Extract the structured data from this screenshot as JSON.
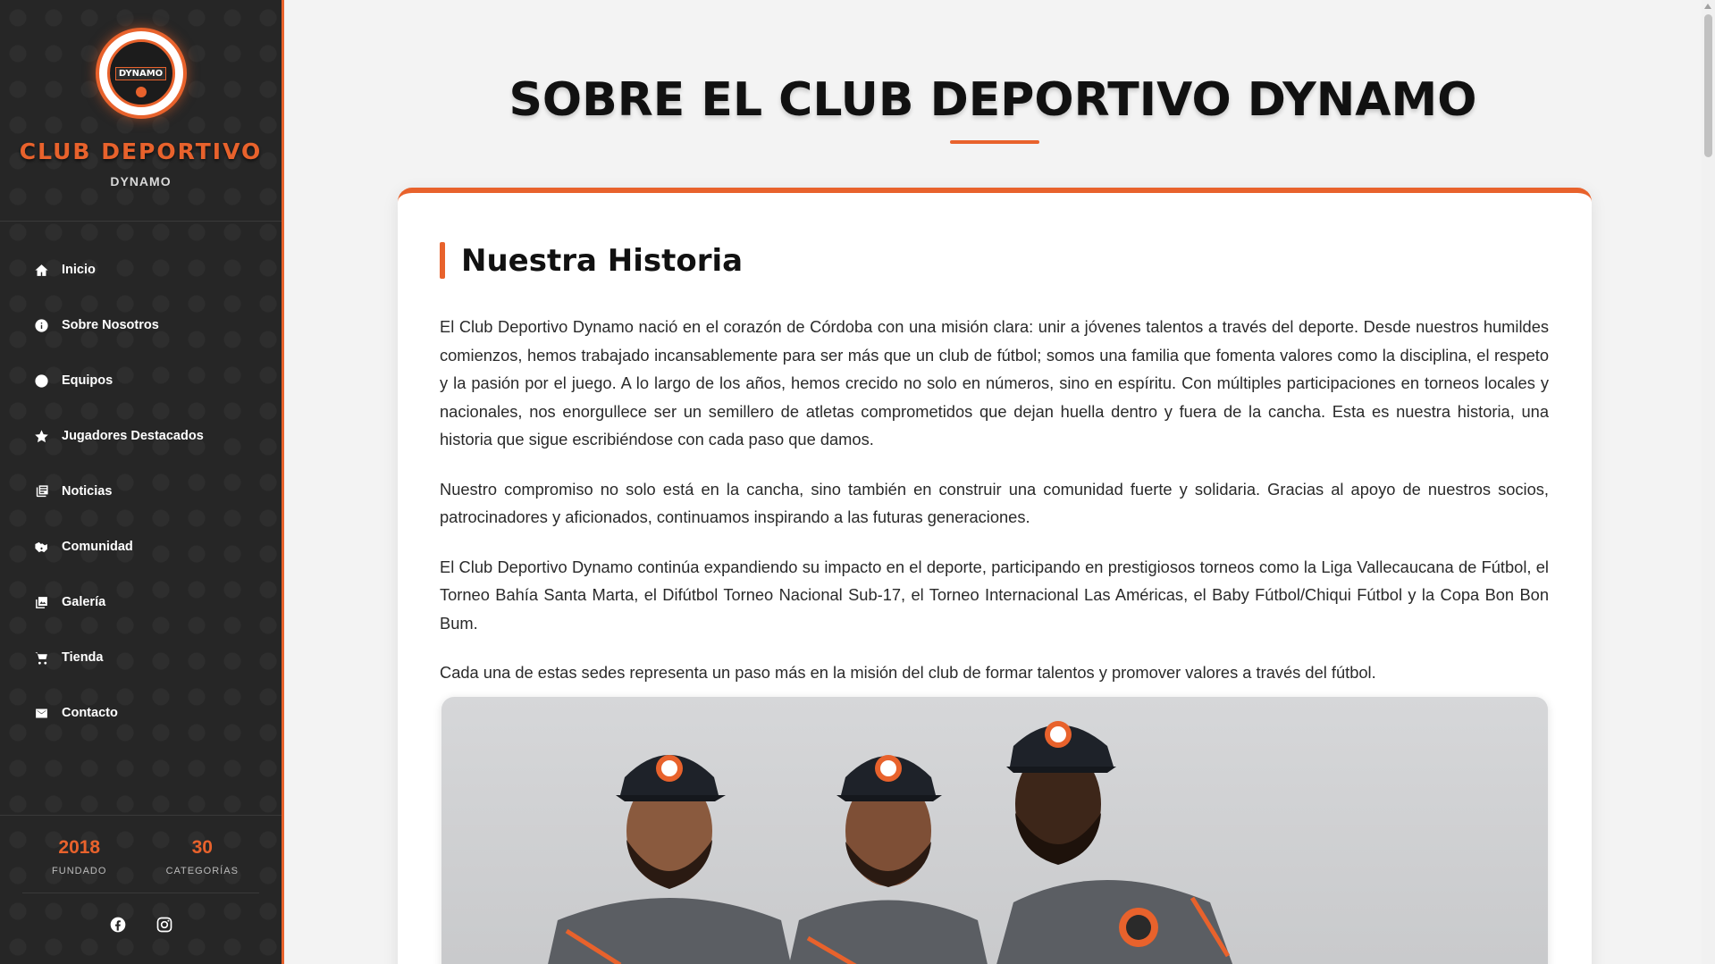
{
  "brand": {
    "logo_text": "DYNAMO",
    "title": "CLUB DEPORTIVO",
    "subtitle": "DYNAMO"
  },
  "nav": {
    "items": [
      {
        "label": "Inicio",
        "icon": "home-icon"
      },
      {
        "label": "Sobre Nosotros",
        "icon": "info-icon"
      },
      {
        "label": "Equipos",
        "icon": "circle-icon"
      },
      {
        "label": "Jugadores Destacados",
        "icon": "star-icon"
      },
      {
        "label": "Noticias",
        "icon": "newspaper-icon"
      },
      {
        "label": "Comunidad",
        "icon": "handshake-icon"
      },
      {
        "label": "Galería",
        "icon": "gallery-icon"
      },
      {
        "label": "Tienda",
        "icon": "cart-icon"
      },
      {
        "label": "Contacto",
        "icon": "mail-icon"
      }
    ]
  },
  "stats": [
    {
      "value": "2018",
      "label": "FUNDADO"
    },
    {
      "value": "30",
      "label": "CATEGORÍAS"
    }
  ],
  "social": [
    "facebook-icon",
    "instagram-icon"
  ],
  "main": {
    "title": "SOBRE EL CLUB DEPORTIVO DYNAMO",
    "section_title": "Nuestra Historia",
    "paragraphs": [
      "El Club Deportivo Dynamo nació en el corazón de Córdoba con una misión clara: unir a jóvenes talentos a través del deporte. Desde nuestros humildes comienzos, hemos trabajado incansablemente para ser más que un club de fútbol; somos una familia que fomenta valores como la disciplina, el respeto y la pasión por el juego. A lo largo de los años, hemos crecido no solo en números, sino en espíritu. Con múltiples participaciones en torneos locales y nacionales, nos enorgullece ser un semillero de atletas comprometidos que dejan huella dentro y fuera de la cancha. Esta es nuestra historia, una historia que sigue escribiéndose con cada paso que damos.",
      "Nuestro compromiso no solo está en la cancha, sino también en construir una comunidad fuerte y solidaria. Gracias al apoyo de nuestros socios, patrocinadores y aficionados, continuamos inspirando a las futuras generaciones.",
      "El Club Deportivo Dynamo continúa expandiendo su impacto en el deporte, participando en prestigiosos torneos como la Liga Vallecaucana de Fútbol, el Torneo Bahía Santa Marta, el Difútbol Torneo Nacional Sub-17, el Torneo Internacional Las Américas, el Baby Fútbol/Chiqui Fútbol y la Copa Bon Bon Bum.",
      "Cada una de estas sedes representa un paso más en la misión del club de formar talentos y promover valores a través del fútbol."
    ]
  },
  "colors": {
    "accent": "#e8622c",
    "sidebar_bg": "#262626",
    "page_bg": "#f3f3f3"
  }
}
